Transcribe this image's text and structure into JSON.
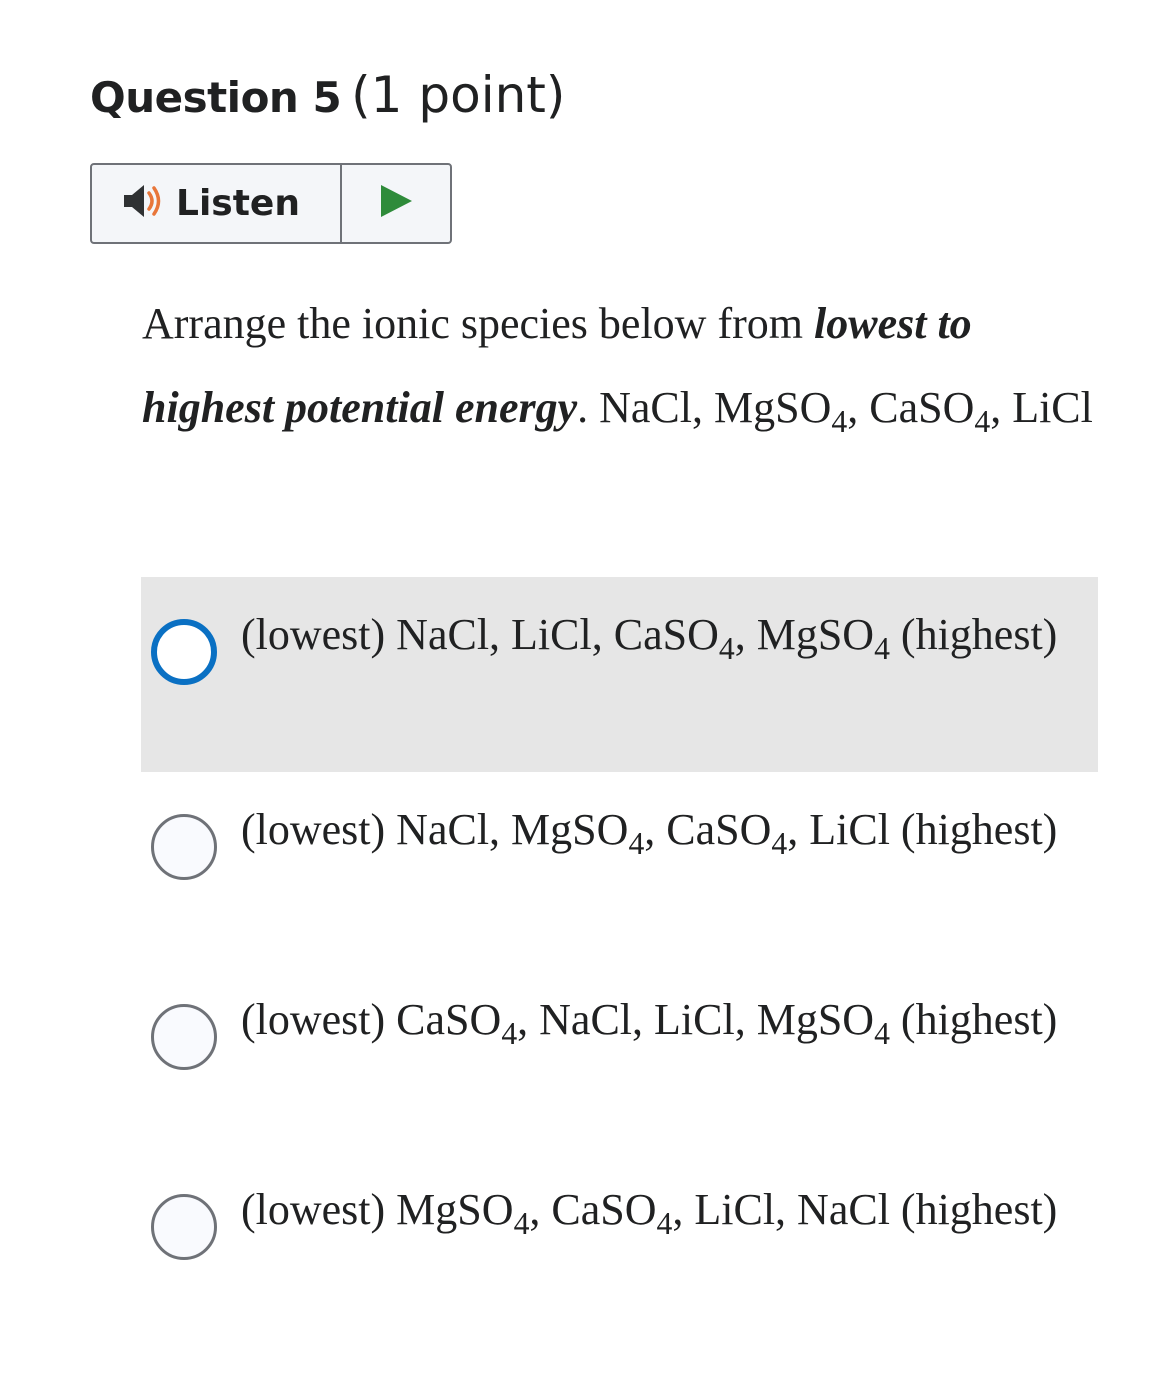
{
  "question": {
    "title": "Question 5",
    "points": "(1 point)"
  },
  "listen": {
    "label": "Listen",
    "speaker_icon": "speaker-icon",
    "play_icon": "play-icon",
    "play_color": "#2e8b3a",
    "speaker_wave_color": "#e8763a"
  },
  "prompt": {
    "p1": "Arrange the ionic species below from ",
    "em": "lowest to highest potential energy",
    "p2": ". NaCl, MgSO",
    "s1": "4",
    "p3": ", CaSO",
    "s2": "4",
    "p4": ", LiCl"
  },
  "choices": [
    {
      "focused": true,
      "parts": [
        "(lowest) NaCl, LiCl, CaSO",
        "4",
        ", MgSO",
        "4",
        " (highest)"
      ]
    },
    {
      "focused": false,
      "parts": [
        "(lowest) NaCl, MgSO",
        "4",
        ", CaSO",
        "4",
        ", LiCl (highest)"
      ]
    },
    {
      "focused": false,
      "parts": [
        "(lowest) CaSO",
        "4",
        ", NaCl, LiCl, MgSO",
        "4",
        " (highest)"
      ]
    },
    {
      "focused": false,
      "parts": [
        "(lowest) MgSO",
        "4",
        ", CaSO",
        "4",
        ", LiCl, NaCl (highest)"
      ]
    }
  ],
  "colors": {
    "focus_ring": "#0a70c3",
    "hover_bg": "#e6e6e6",
    "radio_border": "#6f7278"
  }
}
